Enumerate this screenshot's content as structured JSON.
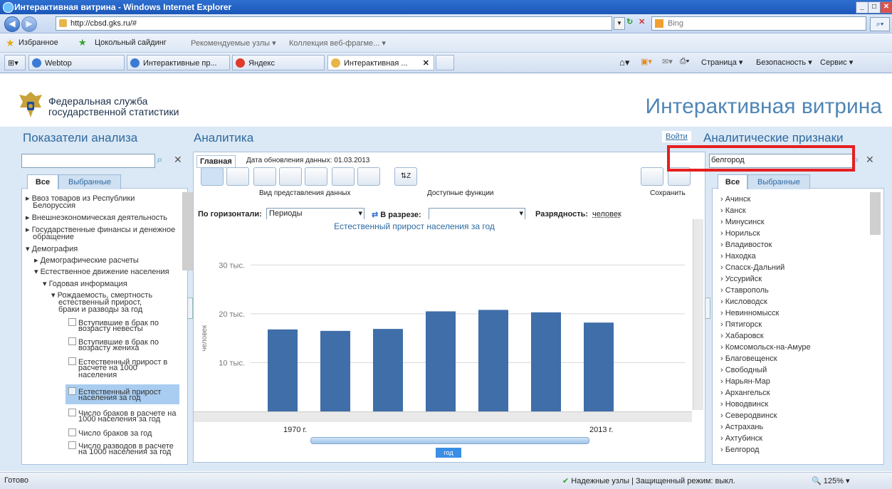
{
  "browser": {
    "title": "Интерактивная витрина - Windows Internet Explorer",
    "url": "http://cbsd.gks.ru/#",
    "search_provider": "Bing",
    "favorites_label": "Избранное",
    "fav_links": [
      "Цокольный сайдинг",
      "Рекомендуемые узлы ▾",
      "Коллекция веб-фрагме... ▾"
    ],
    "tabs": [
      "Webtop",
      "Интерактивные пр...",
      "Яндекс",
      "Интерактивная ..."
    ],
    "toolbar_right": [
      "Страница ▾",
      "Безопасность ▾",
      "Сервис ▾"
    ]
  },
  "site": {
    "org_line1": "Федеральная служба",
    "org_line2": "государственной статистики",
    "title": "Интерактивная витрина",
    "login": "Войти"
  },
  "left": {
    "heading": "Показатели анализа",
    "search_value": "",
    "tab_all": "Все",
    "tab_selected": "Выбранные",
    "tree": [
      "▸ Ввоз товаров из Республики",
      "Белоруссия",
      "▸ Внешнеэкономическая деятельность",
      "▸ Государственные финансы и денежное",
      "обращение",
      "▾ Демография",
      "▸ Демографические расчеты",
      "▾ Естественное движение населения",
      "▾ Годовая информация",
      "▾ Рождаемость, смертность",
      "естественный прирост,",
      "браки и разводы за год",
      "Вступившие в брак по",
      "возрасту невесты",
      "Вступившие в брак по",
      "возрасту жениха",
      "Естественный прирост в",
      "расчете на 1000",
      "населения",
      "Естественный прирост",
      "населения за год",
      "Число браков в расчете на",
      "1000 населения за год",
      "Число браков за год",
      "Число разводов в расчете",
      "на 1000 населения за год"
    ]
  },
  "center": {
    "heading": "Аналитика",
    "tab_main": "Главная",
    "updated": "Дата обновления данных: 01.03.2013",
    "label_view": "Вид представления данных",
    "label_functions": "Доступные функции",
    "label_save": "Сохранить",
    "horizontal_label": "По горизонтали:",
    "horizontal_value": "Периоды",
    "section_label": "В разрезе:",
    "section_value": "",
    "digits_label": "Разрядность:",
    "digits_value": "человек",
    "slider_start": "1970 г.",
    "slider_end": "2013 г.",
    "slider_unit": "год"
  },
  "chart_data": {
    "type": "bar",
    "title": "Естественный прирост населения за год",
    "ylabel": "человек",
    "ylim": [
      0,
      35000
    ],
    "yticks": [
      10000,
      20000,
      30000
    ],
    "ytick_labels": [
      "10 тыс.",
      "20 тыс.",
      "30 тыс."
    ],
    "values": [
      16800,
      16500,
      16900,
      20500,
      20800,
      20300,
      18200
    ]
  },
  "right": {
    "heading": "Аналитические признаки",
    "search_value": "белгород",
    "tab_all": "Все",
    "tab_selected": "Выбранные",
    "cities": [
      "Ачинск",
      "Канск",
      "Минусинск",
      "Норильск",
      "Владивосток",
      "Находка",
      "Спасск-Дальний",
      "Уссурийск",
      "Ставрополь",
      "Кисловодск",
      "Невинномысск",
      "Пятигорск",
      "Хабаровск",
      "Комсомольск-на-Амуре",
      "Благовещенск",
      "Свободный",
      "Нарьян-Мар",
      "Архангельск",
      "Новодвинск",
      "Северодвинск",
      "Астрахань",
      "Ахтубинск",
      "Белгород"
    ]
  },
  "status": {
    "left": "Готово",
    "zone": "Надежные узлы | Защищенный режим: выкл.",
    "zoom": "125%"
  }
}
